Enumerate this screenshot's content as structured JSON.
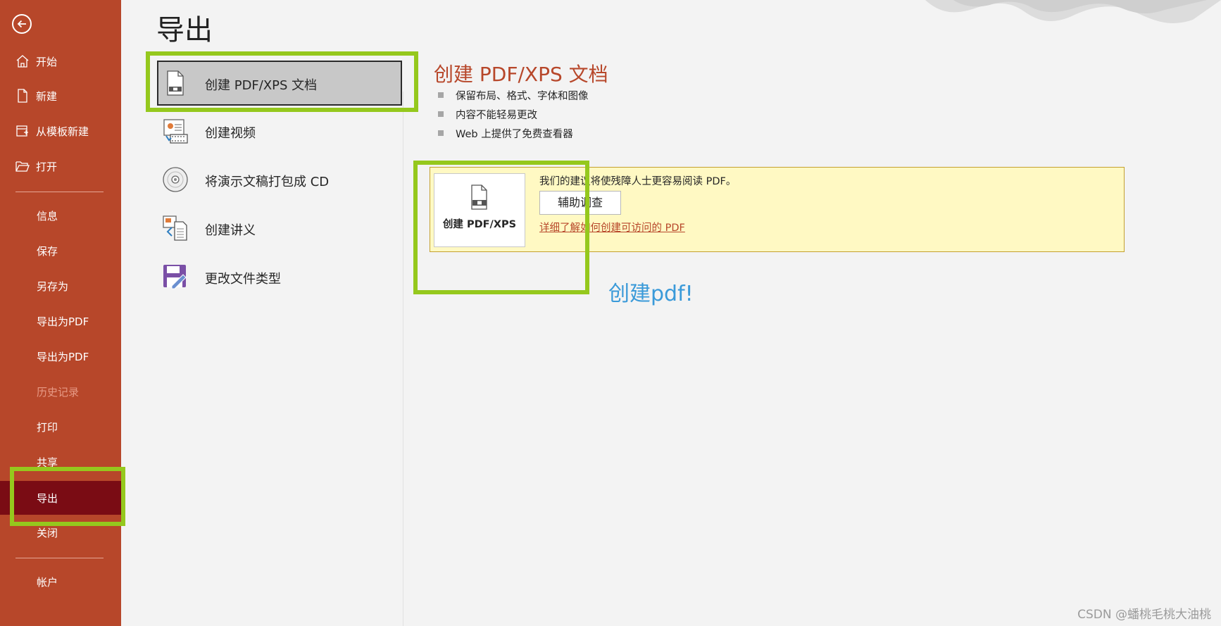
{
  "colors": {
    "sidebar_bg": "#b7472a",
    "sidebar_active": "#7a0c14",
    "accent_title": "#b7472a",
    "notice_bg": "#fff9c3",
    "highlight": "#95c81d",
    "annotation": "#3a9ad9"
  },
  "sidebar": {
    "back_icon": "back-arrow-icon",
    "items": [
      {
        "label": "开始",
        "icon": "home-icon"
      },
      {
        "label": "新建",
        "icon": "new-document-icon"
      },
      {
        "label": "从模板新建",
        "icon": "template-icon"
      },
      {
        "label": "打开",
        "icon": "folder-open-icon"
      },
      {
        "label": "信息"
      },
      {
        "label": "保存"
      },
      {
        "label": "另存为"
      },
      {
        "label": "导出为PDF"
      },
      {
        "label": "导出为PDF"
      },
      {
        "label": "历史记录",
        "disabled": true
      },
      {
        "label": "打印"
      },
      {
        "label": "共享"
      },
      {
        "label": "导出",
        "active": true
      },
      {
        "label": "关闭"
      },
      {
        "label": "帐户"
      }
    ]
  },
  "page": {
    "title": "导出"
  },
  "export_options": [
    {
      "label": "创建 PDF/XPS 文档",
      "icon": "pdf-document-icon",
      "selected": true
    },
    {
      "label": "创建视频",
      "icon": "video-icon"
    },
    {
      "label": "将演示文稿打包成 CD",
      "icon": "cd-icon"
    },
    {
      "label": "创建讲义",
      "icon": "handout-icon"
    },
    {
      "label": "更改文件类型",
      "icon": "save-as-type-icon"
    }
  ],
  "detail": {
    "title": "创建 PDF/XPS 文档",
    "bullets": [
      "保留布局、格式、字体和图像",
      "内容不能轻易更改",
      "Web 上提供了免费查看器"
    ],
    "create_button": "创建 PDF/XPS",
    "notice_text": "我们的建议将使残障人士更容易阅读 PDF。",
    "check_button": "辅助调查",
    "learn_link": "详细了解如何创建可访问的 PDF"
  },
  "annotation": {
    "text": "创建pdf!"
  },
  "watermark": "CSDN @蟠桃毛桃大油桃"
}
